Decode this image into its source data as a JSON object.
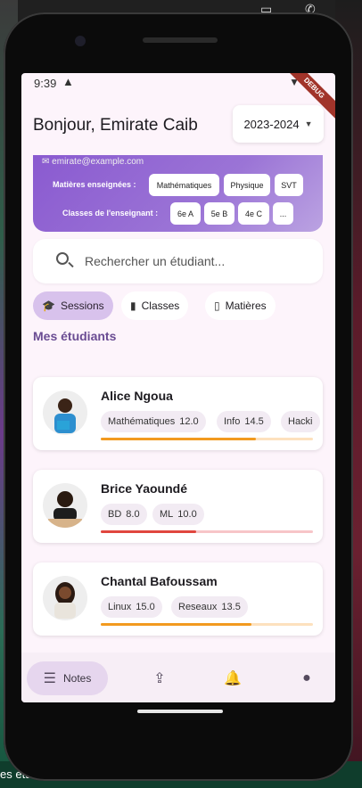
{
  "status": {
    "time": "9:39",
    "warning_icon": "warning-icon",
    "debug_label": "DEBUG"
  },
  "header": {
    "greeting": "Bonjour, Emirate Caib",
    "year": "2023-2024"
  },
  "profile": {
    "email": "emirate@example.com",
    "subjects_label": "Matières enseignées :",
    "subjects": [
      "Mathématiques",
      "Physique",
      "SVT"
    ],
    "classes_label": "Classes de l'enseignant :",
    "classes": [
      "6e A",
      "5e B",
      "4e C",
      "..."
    ]
  },
  "search": {
    "placeholder": "Rechercher un étudiant..."
  },
  "tabs": [
    {
      "label": "Sessions",
      "icon": "graduation-cap-icon",
      "active": true
    },
    {
      "label": "Classes",
      "icon": "book-icon",
      "active": false
    },
    {
      "label": "Matières",
      "icon": "open-book-icon",
      "active": false
    }
  ],
  "section_title": "Mes étudiants",
  "students": [
    {
      "name": "Alice Ngoua",
      "grades": [
        {
          "subject": "Mathématiques",
          "value": "12.0"
        },
        {
          "subject": "Info",
          "value": "14.5"
        },
        {
          "subject": "Hacki",
          "value": ""
        }
      ],
      "progress": 0.73,
      "bar_color": "#f29a1f",
      "track_color": "#fde1be"
    },
    {
      "name": "Brice Yaoundé",
      "grades": [
        {
          "subject": "BD",
          "value": "8.0"
        },
        {
          "subject": "ML",
          "value": "10.0"
        }
      ],
      "progress": 0.45,
      "bar_color": "#e0463e",
      "track_color": "#f7c5c8"
    },
    {
      "name": "Chantal Bafoussam",
      "grades": [
        {
          "subject": "Linux",
          "value": "15.0"
        },
        {
          "subject": "Reseaux",
          "value": "13.5"
        }
      ],
      "progress": 0.71,
      "bar_color": "#f29a1f",
      "track_color": "#fde1be"
    }
  ],
  "bottom_nav": [
    {
      "label": "Notes",
      "icon": "notes-list-icon",
      "active": true
    },
    {
      "label": "",
      "icon": "upload-icon",
      "active": false
    },
    {
      "label": "",
      "icon": "bell-icon",
      "active": false
    },
    {
      "label": "",
      "icon": "person-icon",
      "active": false
    }
  ],
  "backdrop": {
    "bottom_text": "es étu"
  }
}
